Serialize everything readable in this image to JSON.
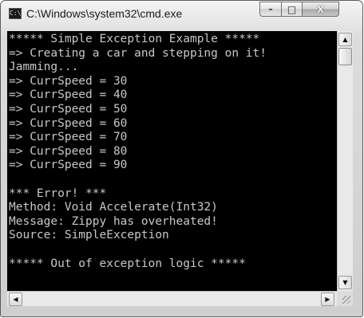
{
  "window": {
    "title": "C:\\Windows\\system32\\cmd.exe",
    "icon_text": "C:\\"
  },
  "controls": {
    "minimize_glyph": "–",
    "maximize_glyph": "□",
    "close_glyph": "X"
  },
  "console": {
    "lines": [
      "***** Simple Exception Example *****",
      "=> Creating a car and stepping on it!",
      "Jamming...",
      "=> CurrSpeed = 30",
      "=> CurrSpeed = 40",
      "=> CurrSpeed = 50",
      "=> CurrSpeed = 60",
      "=> CurrSpeed = 70",
      "=> CurrSpeed = 80",
      "=> CurrSpeed = 90",
      "",
      "*** Error! ***",
      "Method: Void Accelerate(Int32)",
      "Message: Zippy has overheated!",
      "Source: SimpleException",
      "",
      "***** Out of exception logic *****"
    ]
  },
  "scrollbars": {
    "up_glyph": "▲",
    "down_glyph": "▼",
    "left_glyph": "◀",
    "right_glyph": "▶"
  }
}
